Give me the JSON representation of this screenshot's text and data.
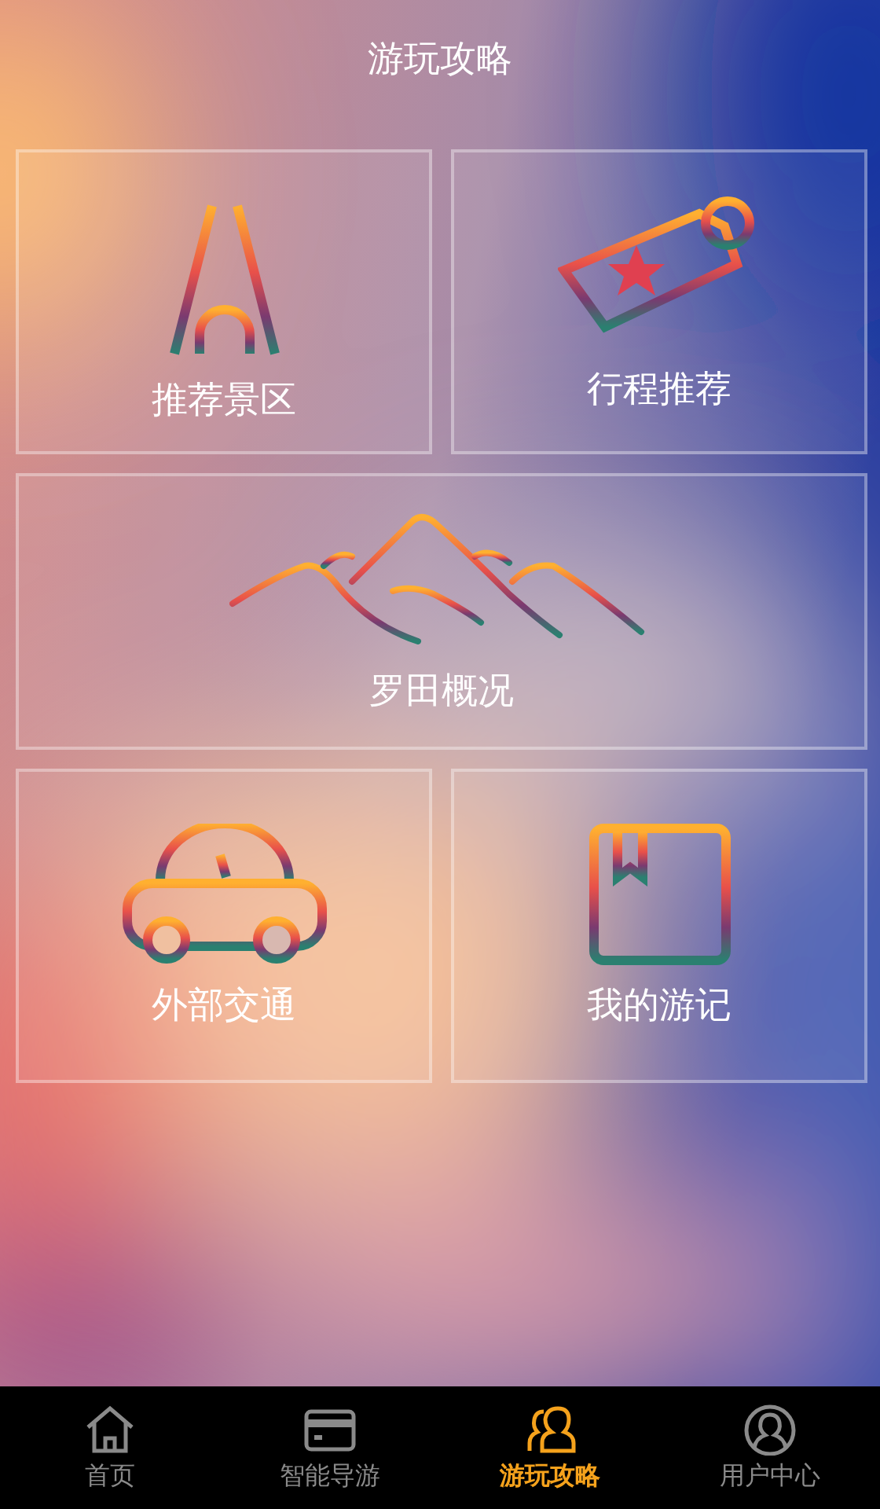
{
  "header": {
    "title": "游玩攻略"
  },
  "tiles": [
    {
      "kind": "tower",
      "label": "推荐景区"
    },
    {
      "kind": "tag",
      "label": "行程推荐"
    },
    {
      "kind": "mountain",
      "label": "罗田概况"
    },
    {
      "kind": "car",
      "label": "外部交通"
    },
    {
      "kind": "book",
      "label": "我的游记"
    }
  ],
  "tab_bar": [
    {
      "kind": "home",
      "label": "首页",
      "selected": false
    },
    {
      "kind": "card",
      "label": "智能导游",
      "selected": false
    },
    {
      "kind": "people",
      "label": "游玩攻略",
      "selected": true
    },
    {
      "kind": "user",
      "label": "用户中心",
      "selected": false
    }
  ]
}
